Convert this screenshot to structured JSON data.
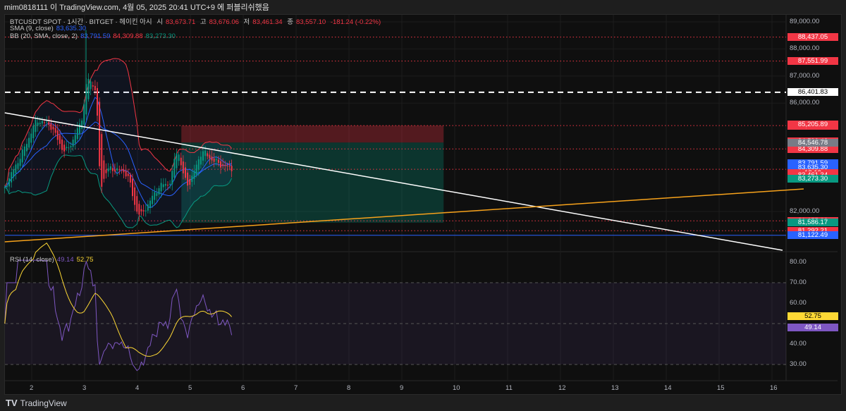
{
  "publish_line": "mim0818111 이 TradingView.com, 4월 05, 2025 20:41 UTC+9 에 퍼블리쉬했음",
  "legend": {
    "symbol": "BTCUSDT SPOT · 1시간 · BITGET · 헤이킨 아시",
    "o_label": "시",
    "o": "83,673.71",
    "h_label": "고",
    "h": "83,676.06",
    "l_label": "저",
    "l": "83,461.34",
    "c_label": "종",
    "c": "83,557.10",
    "change": "-181.24 (-0.22%)",
    "sma_label": "SMA (9, close)",
    "sma": "83,635.30",
    "bb_label": "BB (20, SMA, close, 2)",
    "bb_mid": "83,791.59",
    "bb_upper": "84,309.88",
    "bb_lower": "83,273.30",
    "rsi_label": "RSI (14, close)",
    "rsi": "49.14",
    "rsi_ma": "52.75"
  },
  "footer": {
    "brand": "TradingView"
  },
  "colors": {
    "up": "#089981",
    "down": "#f23645",
    "sma": "#2962ff",
    "bb_upper": "#f23645",
    "bb_lower": "#089981",
    "rsi": "#7e57c2",
    "rsi_ma": "#fdd835",
    "trend_white": "#ffffff",
    "trend_orange": "#f7a21b"
  },
  "chart_data": [
    {
      "type": "candlestick",
      "style": "heikin-ashi",
      "interval": "1h",
      "price_axis": {
        "ticks": [
          "89,000.00",
          "88,000.00",
          "87,000.00",
          "86,000.00",
          "82,000.00"
        ],
        "range": [
          80600,
          89300
        ]
      },
      "x_axis": {
        "ticks": [
          "2",
          "3",
          "4",
          "5",
          "6",
          "7",
          "8",
          "9",
          "10",
          "11",
          "12",
          "13",
          "14",
          "15",
          "16"
        ]
      },
      "approx_close": [
        [
          1.49,
          83000
        ],
        [
          1.8,
          84160
        ],
        [
          2.07,
          85380
        ],
        [
          2.33,
          85200
        ],
        [
          2.6,
          84160
        ],
        [
          2.73,
          84520
        ],
        [
          2.93,
          85380
        ],
        [
          3.03,
          86940
        ],
        [
          3.2,
          86500
        ],
        [
          3.27,
          82780
        ],
        [
          3.4,
          83560
        ],
        [
          3.6,
          83560
        ],
        [
          3.8,
          83380
        ],
        [
          3.93,
          82180
        ],
        [
          4.04,
          81820
        ],
        [
          4.2,
          82340
        ],
        [
          4.4,
          82960
        ],
        [
          4.6,
          83040
        ],
        [
          4.73,
          84420
        ],
        [
          4.84,
          83380
        ],
        [
          4.93,
          82900
        ],
        [
          5.07,
          83560
        ],
        [
          5.2,
          84260
        ],
        [
          5.33,
          84000
        ],
        [
          5.53,
          83740
        ],
        [
          5.8,
          83557
        ]
      ],
      "spike_high": {
        "day": 3.2,
        "price": 88700
      },
      "horizontal_lines": [
        {
          "price": 88437.05,
          "label": "88,437.05",
          "style": "dotted",
          "color": "#f23645"
        },
        {
          "price": 87551.99,
          "label": "87,551.99",
          "style": "dotted",
          "color": "#f23645"
        },
        {
          "price": 86401.83,
          "label": "86,401.83",
          "style": "dashed",
          "color": "#ffffff"
        },
        {
          "price": 85170.25,
          "label": "85,170.25",
          "style": "dotted",
          "color": "#f23645"
        },
        {
          "price": 84309.88,
          "label": "84,309.88",
          "style": "dotted",
          "color": "#f23645"
        },
        {
          "price": 83557.1,
          "label": "83,557.10",
          "style": "dotted",
          "color": "#f23645"
        },
        {
          "price": 81655.33,
          "label": "81,655.33",
          "style": "dotted",
          "color": "#f23645"
        },
        {
          "price": 81292.21,
          "label": "81,292.21",
          "style": "dotted",
          "color": "#f23645"
        },
        {
          "price": 81122.49,
          "label": "81,122.49",
          "style": "solid",
          "color": "#2962ff"
        }
      ],
      "price_labels": [
        {
          "label": "85,205.89",
          "price": 85205.89,
          "color": "#f23645"
        },
        {
          "label": "84,590.43",
          "price": 84590.43,
          "color": "#f23645"
        },
        {
          "label": "84,546.78",
          "price": 84546.78,
          "color": "#787b86"
        },
        {
          "label": "83,791.59",
          "price": 83791.59,
          "color": "#2962ff"
        },
        {
          "label": "83,635.30",
          "price": 83635.3,
          "color": "#2962ff"
        },
        {
          "label": "18:12",
          "price": 83420,
          "color": "#f23645"
        },
        {
          "label": "83,461.34",
          "price": 83340,
          "color": "#f23645"
        },
        {
          "label": "83,273.30",
          "price": 83200,
          "color": "#089981"
        },
        {
          "label": "81,586.17",
          "price": 81586.17,
          "color": "#089981"
        }
      ],
      "trendlines": [
        {
          "color": "#ffffff",
          "from": [
            1.49,
            85643
          ],
          "to": [
            16.2,
            80570
          ]
        },
        {
          "color": "#f7a21b",
          "from": [
            1.49,
            80880
          ],
          "to": [
            16.6,
            82833
          ]
        }
      ],
      "position": {
        "from_day": 4.83,
        "to_day": 9.79,
        "stop": 85170.25,
        "entry": 84546.78,
        "target": 81586.17
      }
    },
    {
      "type": "line",
      "name": "RSI (14, close)",
      "y_axis": {
        "ticks": [
          "80.00",
          "70.00",
          "60.00",
          "40.00",
          "30.00"
        ],
        "range": [
          26,
          82
        ]
      },
      "levels": [
        70,
        50,
        30
      ],
      "last": {
        "rsi": 49.14,
        "ma": 52.75
      }
    }
  ]
}
